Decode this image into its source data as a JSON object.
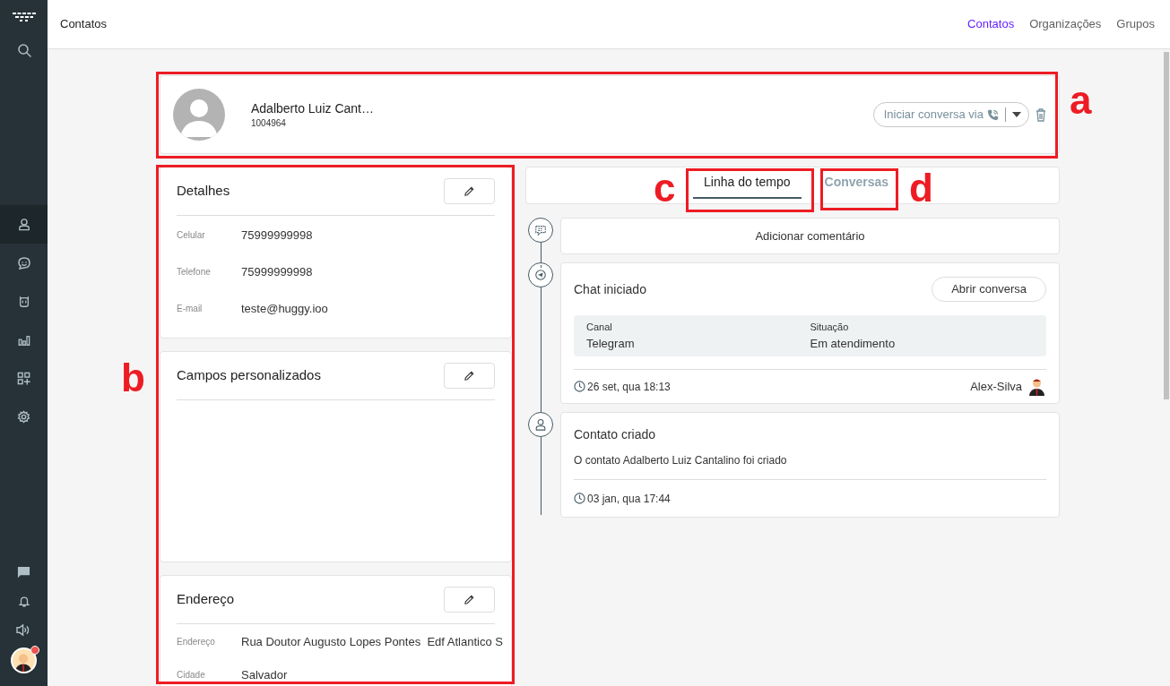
{
  "sidebar": {
    "top": [
      {
        "kind": "logo",
        "selected": false
      },
      {
        "kind": "search",
        "selected": false
      }
    ],
    "nav": [
      {
        "kind": "contacts",
        "selected": true
      },
      {
        "kind": "chat-bot",
        "selected": false
      },
      {
        "kind": "robot",
        "selected": false
      },
      {
        "kind": "reports",
        "selected": false
      },
      {
        "kind": "apps",
        "selected": false
      },
      {
        "kind": "settings",
        "selected": false
      }
    ],
    "bottom": [
      {
        "kind": "message",
        "selected": false
      },
      {
        "kind": "bell",
        "selected": false
      },
      {
        "kind": "sound",
        "selected": false
      }
    ],
    "user": {
      "notification": true
    }
  },
  "top_bar": {
    "title": "Contatos",
    "links": [
      {
        "label": "Contatos",
        "selected": true
      },
      {
        "label": "Organizações",
        "selected": false
      },
      {
        "label": "Grupos",
        "selected": false
      }
    ]
  },
  "contact": {
    "name": "Adalberto Luiz Cant…",
    "id": "1004964",
    "start_button": "Iniciar conversa via"
  },
  "sections": [
    {
      "title": "Detalhes",
      "fields": [
        {
          "label": "Celular",
          "value": "75999999998"
        },
        {
          "label": "Telefone",
          "value": "75999999998"
        },
        {
          "label": "E-mail",
          "value": "teste@huggy.ioo"
        }
      ]
    },
    {
      "title": "Campos personalizados"
    },
    {
      "title": "Endereço",
      "fields": [
        {
          "label": "Endereço",
          "value": "Rua Doutor Augusto Lopes Pontes  Edf Atlantico S"
        },
        {
          "label": "Cidade",
          "value": "Salvador"
        }
      ]
    }
  ],
  "tabs": [
    {
      "label": "Linha do tempo",
      "selected": true
    },
    {
      "label": "Conversas",
      "selected": false
    }
  ],
  "timeline": {
    "add_comment": "Adicionar comentário",
    "events": [
      {
        "kind": "chat",
        "title": "Chat iniciado",
        "button": "Abrir conversa",
        "details": [
          {
            "label": "Canal",
            "value": "Telegram"
          },
          {
            "label": "Situação",
            "value": "Em atendimento"
          }
        ],
        "time": "26 set, qua 18:13",
        "agent": "Alex-Silva"
      },
      {
        "kind": "created",
        "title": "Contato criado",
        "text": "O contato Adalberto Luiz Cantalino foi criado",
        "time": "03 jan, qua 17:44"
      }
    ]
  },
  "annotations": [
    {
      "label": "a"
    },
    {
      "label": "b"
    },
    {
      "label": "c"
    },
    {
      "label": "d"
    }
  ]
}
